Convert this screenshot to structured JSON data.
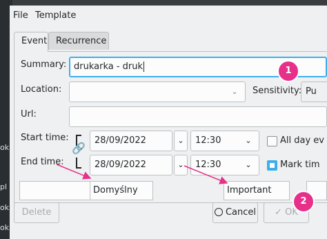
{
  "menubar": {
    "file": "File",
    "template": "Template"
  },
  "tabs": [
    {
      "label": "Event",
      "active": true
    },
    {
      "label": "Recurrence",
      "active": false
    }
  ],
  "form": {
    "summary_label": "Summary:",
    "summary_value": "drukarka - druk",
    "location_label": "Location:",
    "location_value": "",
    "sensitivity_label": "Sensitivity:",
    "sensitivity_value": "Pu",
    "url_label": "Url:",
    "url_value": "",
    "start_label": "Start time:",
    "start_date": "28/09/2022",
    "start_time": "12:30",
    "all_day_label": "All day ev",
    "all_day_checked": false,
    "end_label": "End time:",
    "end_date": "28/09/2022",
    "end_time": "12:30",
    "mark_time_label": "Mark tim",
    "mark_time_checked": true
  },
  "bottom_fields": {
    "calendar": "Domyślny",
    "priority": "Important"
  },
  "buttons": {
    "delete": "Delete",
    "cancel": "Cancel",
    "ok": "OK"
  },
  "badges": {
    "one": "1",
    "two": "2"
  },
  "background_text": {
    "a": "ok",
    "b": "pl",
    "c": "ok",
    "d": "ok",
    "e": "ok"
  },
  "colors": {
    "accent": "#3daee9",
    "badge": "#e6308a",
    "arrow": "#e6308a"
  }
}
